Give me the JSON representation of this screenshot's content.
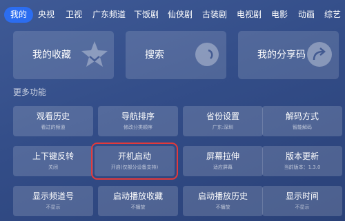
{
  "nav": {
    "tabs": [
      {
        "label": "我的",
        "active": true
      },
      {
        "label": "央视"
      },
      {
        "label": "卫视"
      },
      {
        "label": "广东频道"
      },
      {
        "label": "下饭剧"
      },
      {
        "label": "仙侠剧"
      },
      {
        "label": "古装剧"
      },
      {
        "label": "电视剧"
      },
      {
        "label": "电影"
      },
      {
        "label": "动画"
      },
      {
        "label": "综艺"
      }
    ]
  },
  "cards": {
    "favorites": "我的收藏",
    "search": "搜索",
    "share_code": "我的分享码"
  },
  "section": {
    "title": "更多功能"
  },
  "tiles": [
    {
      "title": "观看历史",
      "sub": "看过的频道"
    },
    {
      "title": "导航排序",
      "sub": "修改分类顺序"
    },
    {
      "title": "省份设置",
      "sub": "广东:深圳"
    },
    {
      "title": "解码方式",
      "sub": "智能解码"
    },
    {
      "title": "上下键反转",
      "sub": "关闭"
    },
    {
      "title": "开机启动",
      "sub": "开启(仅部分设备支持)"
    },
    {
      "title": "屏幕拉伸",
      "sub": "适应屏幕"
    },
    {
      "title": "版本更新",
      "sub": "当前版本：1.3.0"
    },
    {
      "title": "显示频道号",
      "sub": "不显示"
    },
    {
      "title": "启动播放收藏",
      "sub": "不播放"
    },
    {
      "title": "启动播放历史",
      "sub": "不播放"
    },
    {
      "title": "显示时间",
      "sub": "不显示"
    }
  ],
  "colors": {
    "active_tab": "#2c6df0",
    "focus_outline": "#e33a3a",
    "background": "#334d88"
  }
}
